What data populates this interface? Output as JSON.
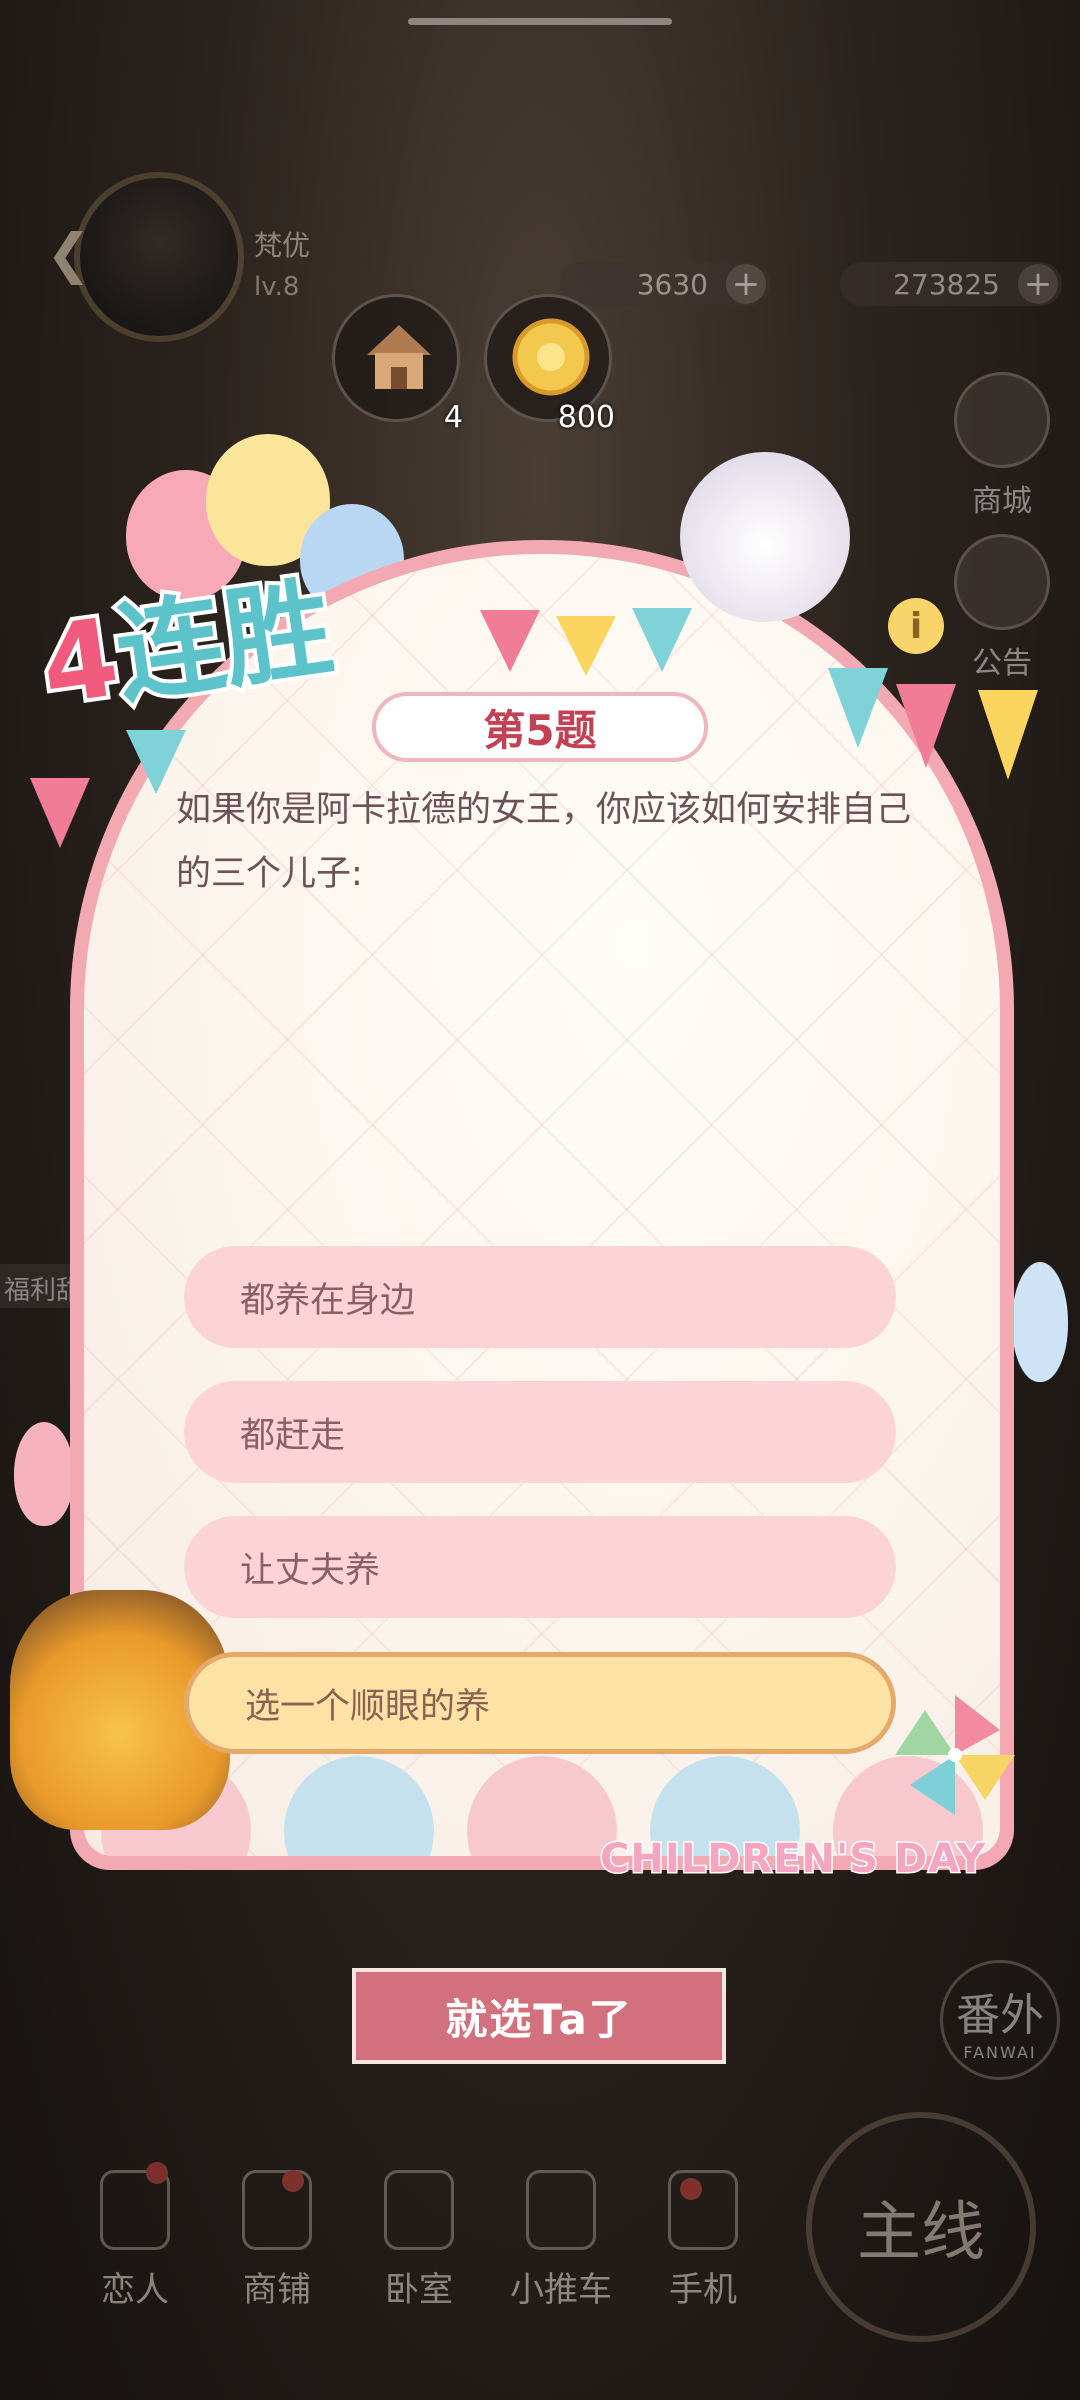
{
  "player": {
    "name": "梵优",
    "level": "lv.8"
  },
  "resources": [
    {
      "value": "3630",
      "plus": "+"
    },
    {
      "value": "273825",
      "plus": "+"
    }
  ],
  "items": [
    {
      "icon": "house-icon",
      "count": "4"
    },
    {
      "icon": "gold-coin-icon",
      "count": "800"
    }
  ],
  "side_menu": [
    {
      "label": "商城",
      "icon": "shop-character-icon"
    },
    {
      "label": "公告",
      "icon": "megaphone-icon"
    }
  ],
  "sidebar_fragment": "福利甜",
  "quiz": {
    "streak_number": "4",
    "streak_text": "连胜",
    "question_title": "第5题",
    "question_text": "如果你是阿卡拉德的女王，你应该如何安排自己的三个儿子:",
    "options": [
      "都养在身边",
      "都赶走",
      "让丈夫养",
      "选一个顺眼的养"
    ],
    "selected_index": 3,
    "confirm_label": "就选Ta了",
    "event_label": "CHILDREN'S DAY",
    "info": "i"
  },
  "fanwai": {
    "label": "番外",
    "sub": "FANWAI"
  },
  "mainline_label": "主线",
  "bottom_nav": [
    {
      "label": "恋人",
      "icon": "lover-icon"
    },
    {
      "label": "商铺",
      "icon": "shopping-bag-icon"
    },
    {
      "label": "卧室",
      "icon": "bedroom-icon"
    },
    {
      "label": "小推车",
      "icon": "cart-icon"
    },
    {
      "label": "手机",
      "icon": "phone-icon"
    }
  ],
  "colors": {
    "accent_pink": "#f2a9b2",
    "option_pink": "#fcd4d8",
    "selected": "#fde2a6",
    "title_red": "#c34154",
    "confirm": "#d2707e"
  }
}
